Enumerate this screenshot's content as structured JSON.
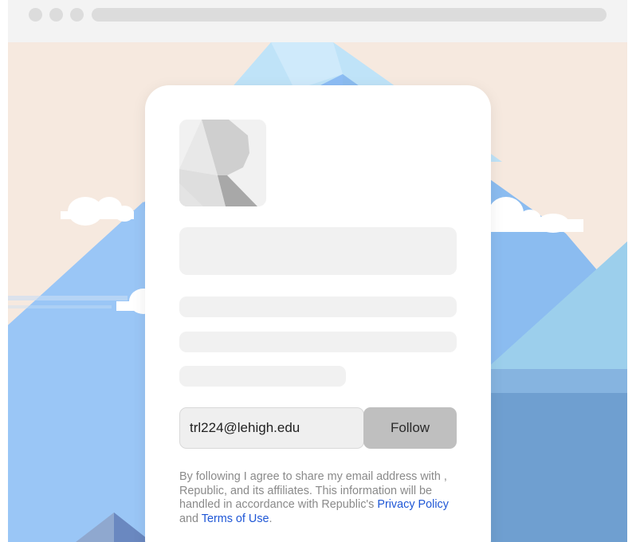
{
  "browser": {
    "window_controls": [
      "close",
      "minimize",
      "maximize"
    ]
  },
  "form": {
    "email_value": "trl224@lehigh.edu",
    "follow_label": "Follow"
  },
  "consent": {
    "text_before": "By following I agree to share my email address with , Republic, and its affiliates. This information will be handled in accordance with Republic's ",
    "privacy_link": "Privacy Policy",
    "text_middle": " and ",
    "terms_link": "Terms of Use",
    "text_end": "."
  },
  "colors": {
    "sky": "#f6e9df",
    "mountain_blue": "#8cbcf4",
    "mountain_light": "#a6d6ef",
    "water": "#6f9fd0",
    "link": "#1f57d6",
    "button": "#bfbfbf"
  },
  "icons": {
    "logo": "republic-logo-icon"
  }
}
